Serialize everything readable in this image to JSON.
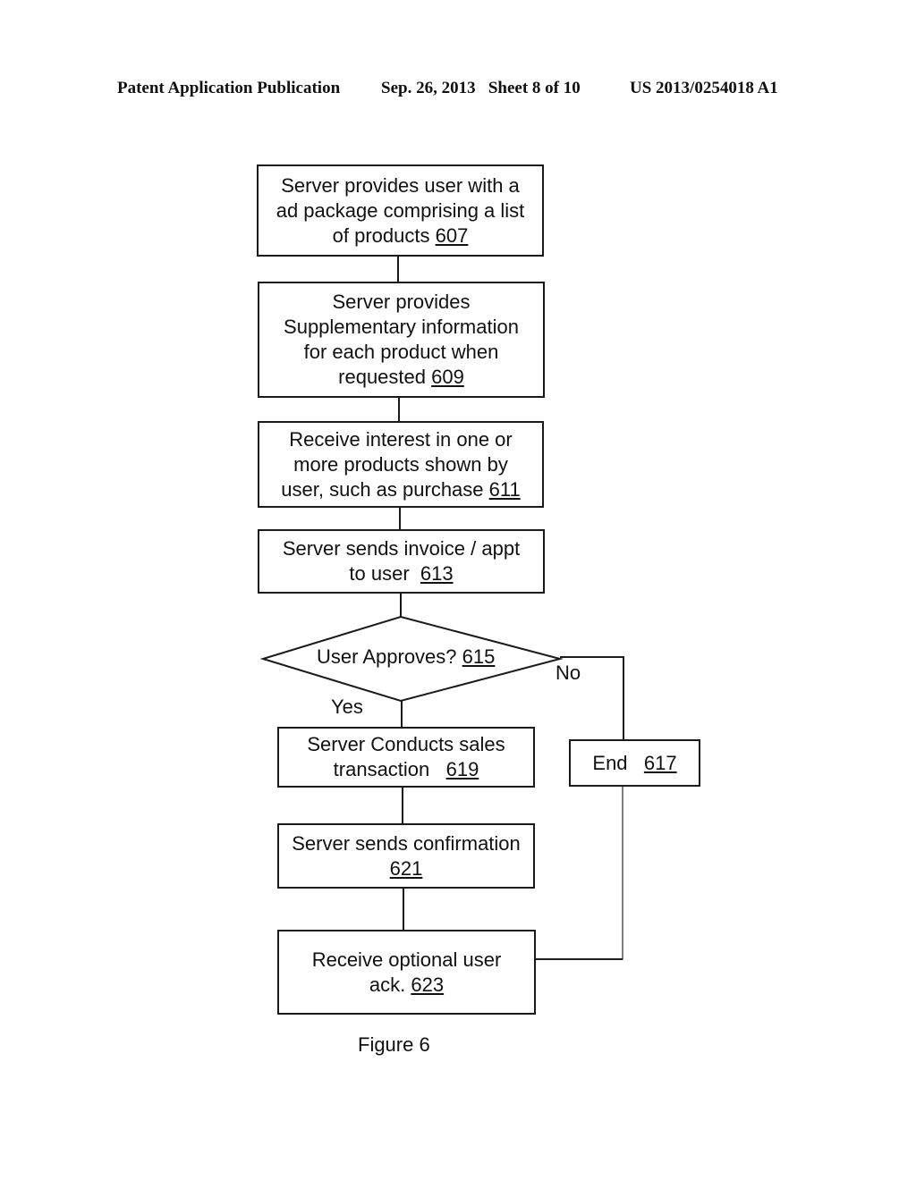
{
  "header": {
    "publication": "Patent Application Publication",
    "date_sheet": "Sep. 26, 2013   Sheet 8 of 10",
    "patent_number": "US 2013/0254018 A1"
  },
  "flowchart": {
    "steps": [
      {
        "id": "607",
        "text": "Server provides user with a ad package comprising a list of products",
        "lines": [
          "Server provides user with a",
          "ad package comprising a list",
          "of products "
        ],
        "ref": "607"
      },
      {
        "id": "609",
        "text": "Server provides Supplementary information for each product when requested",
        "lines": [
          "Server provides",
          "Supplementary information",
          "for each product when",
          "requested "
        ],
        "ref": "609"
      },
      {
        "id": "611",
        "text": "Receive interest in one or more products shown by user, such as purchase",
        "lines": [
          "Receive interest in one or",
          "more products shown by",
          "user, such as purchase "
        ],
        "ref": "611"
      },
      {
        "id": "613",
        "text": "Server sends invoice / appt to user",
        "lines": [
          "Server sends invoice / appt",
          "to user  "
        ],
        "ref": "613"
      },
      {
        "id": "619",
        "text": "Server Conducts sales transaction",
        "lines": [
          "Server Conducts sales",
          "transaction   "
        ],
        "ref": "619"
      },
      {
        "id": "621",
        "text": "Server sends confirmation",
        "lines": [
          "Server sends confirmation",
          ""
        ],
        "ref": "621"
      },
      {
        "id": "623",
        "text": "Receive optional user ack.",
        "lines": [
          "Receive optional user",
          "ack. "
        ],
        "ref": "623"
      },
      {
        "id": "617",
        "text": "End",
        "lines": [
          "End   "
        ],
        "ref": "617"
      }
    ],
    "decision": {
      "id": "615",
      "text": "User Approves? ",
      "ref": "615"
    },
    "branch_labels": {
      "yes": "Yes",
      "no": "No"
    },
    "caption": "Figure 6"
  }
}
